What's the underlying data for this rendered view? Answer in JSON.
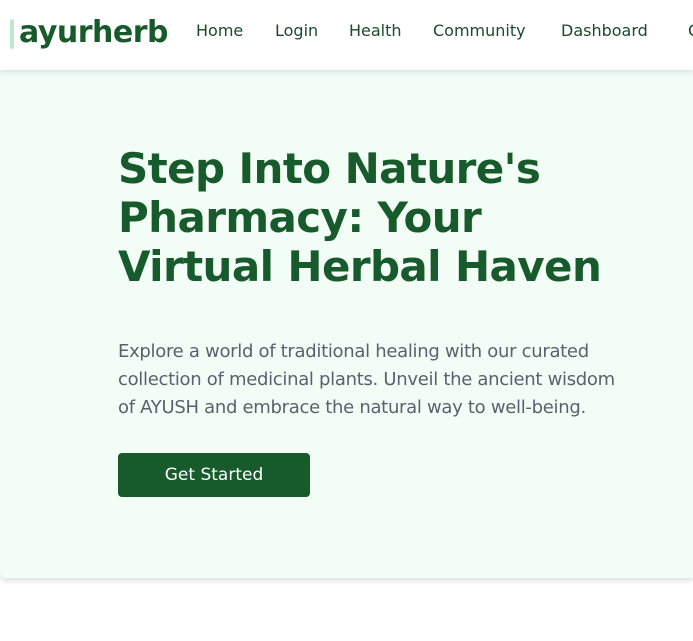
{
  "brand": {
    "name": "ayurherb"
  },
  "nav": {
    "items": [
      {
        "label": "Home"
      },
      {
        "label": "Login"
      },
      {
        "label": "Health"
      },
      {
        "label": "Community"
      },
      {
        "label": "Dashboard"
      }
    ],
    "overflow_glyph": "C"
  },
  "hero": {
    "title": "Step Into Nature's\nPharmacy: Your\nVirtual Herbal Haven",
    "description": "Explore a world of traditional healing with our curated\ncollection of medicinal plants. Unveil the ancient wisdom\nof AYUSH and embrace the natural way to well-being.",
    "cta_label": "Get Started"
  },
  "colors": {
    "primary_green": "#175a2b",
    "hero_background": "#f2fdf5",
    "body_text": "#5b6070",
    "logo_accent": "#bfe9cd"
  }
}
